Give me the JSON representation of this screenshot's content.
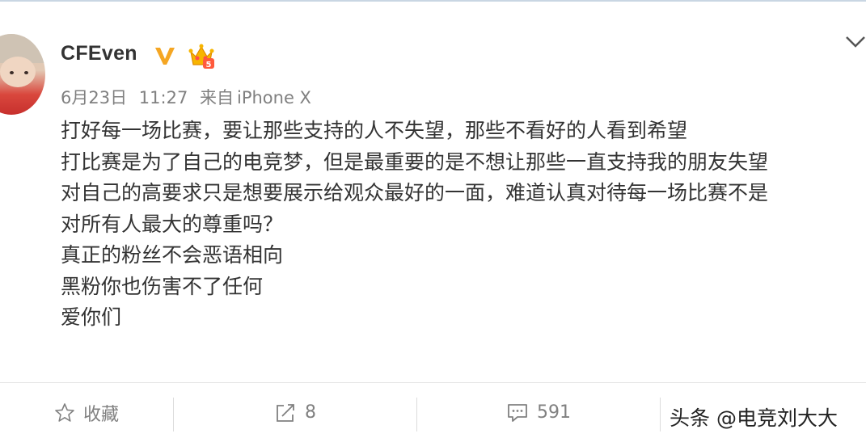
{
  "post": {
    "username": "CFEven",
    "vip_icon": "verified-v-badge",
    "crown_icon": "vip-crown-badge",
    "date": "6月23日",
    "time": "11:27",
    "source_prefix": "来自",
    "source": "iPhone X",
    "lines": [
      "打好每一场比赛，要让那些支持的人不失望，那些不看好的人看到希望",
      "打比赛是为了自己的电竞梦，但是最重要的是不想让那些一直支持我的朋友失望",
      "对自己的高要求只是想要展示给观众最好的一面，难道认真对待每一场比赛不是",
      "对所有人最大的尊重吗？",
      "真正的粉丝不会恶语相向",
      "黑粉你也伤害不了任何",
      "爱你们"
    ]
  },
  "actions": {
    "favorite_label": "收藏",
    "repost_count": "8",
    "comment_count": "591"
  },
  "watermark": "头条 @电竞刘大大",
  "colors": {
    "text": "#333333",
    "meta": "#808080",
    "vip_gold": "#f5a623"
  }
}
